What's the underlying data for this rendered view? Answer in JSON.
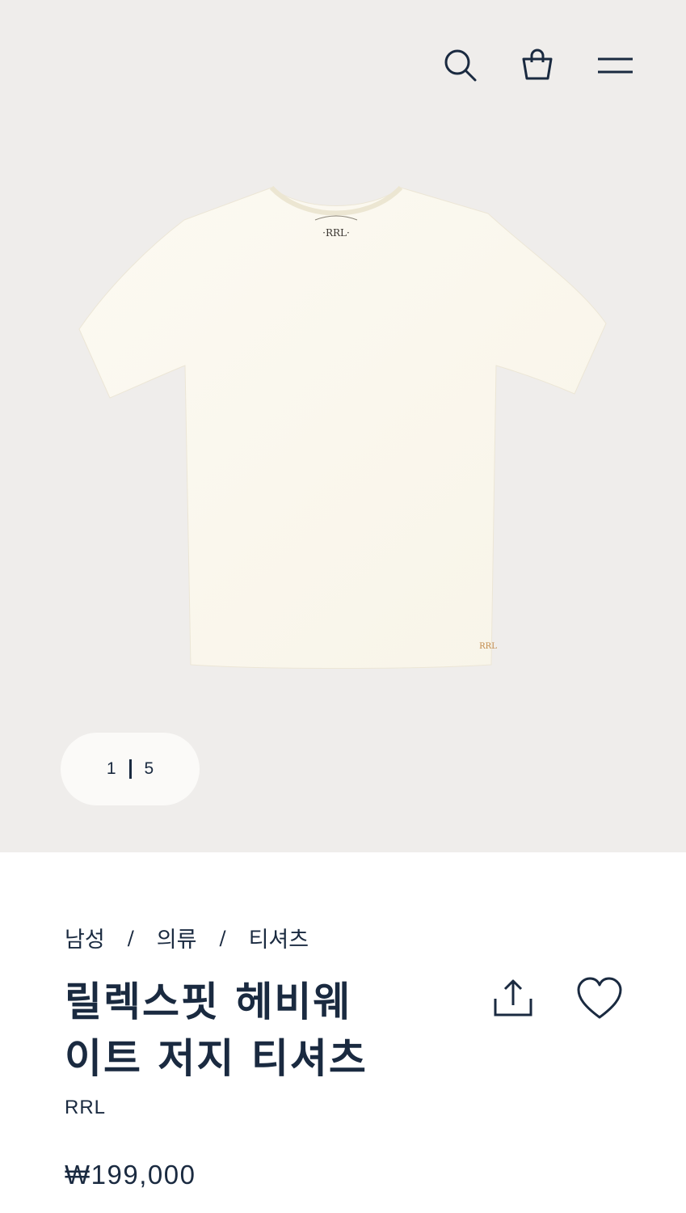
{
  "header": {
    "icons": [
      "search-icon",
      "shopping-bag-icon",
      "menu-icon"
    ]
  },
  "gallery": {
    "current": "1",
    "total": "5"
  },
  "breadcrumb": {
    "items": [
      "남성",
      "의류",
      "티셔츠"
    ],
    "separator": "/"
  },
  "product": {
    "title_line1": "릴렉스핏 헤비웨",
    "title_line2": "이트 저지 티셔츠",
    "brand": "RRL",
    "price": "₩199,000",
    "logo_text": "RRL"
  },
  "colors": {
    "hero_bg": "#efedeb",
    "text": "#1a2a40",
    "shirt": "#fbf8ef",
    "logo_embroidery": "#c28a4a"
  }
}
